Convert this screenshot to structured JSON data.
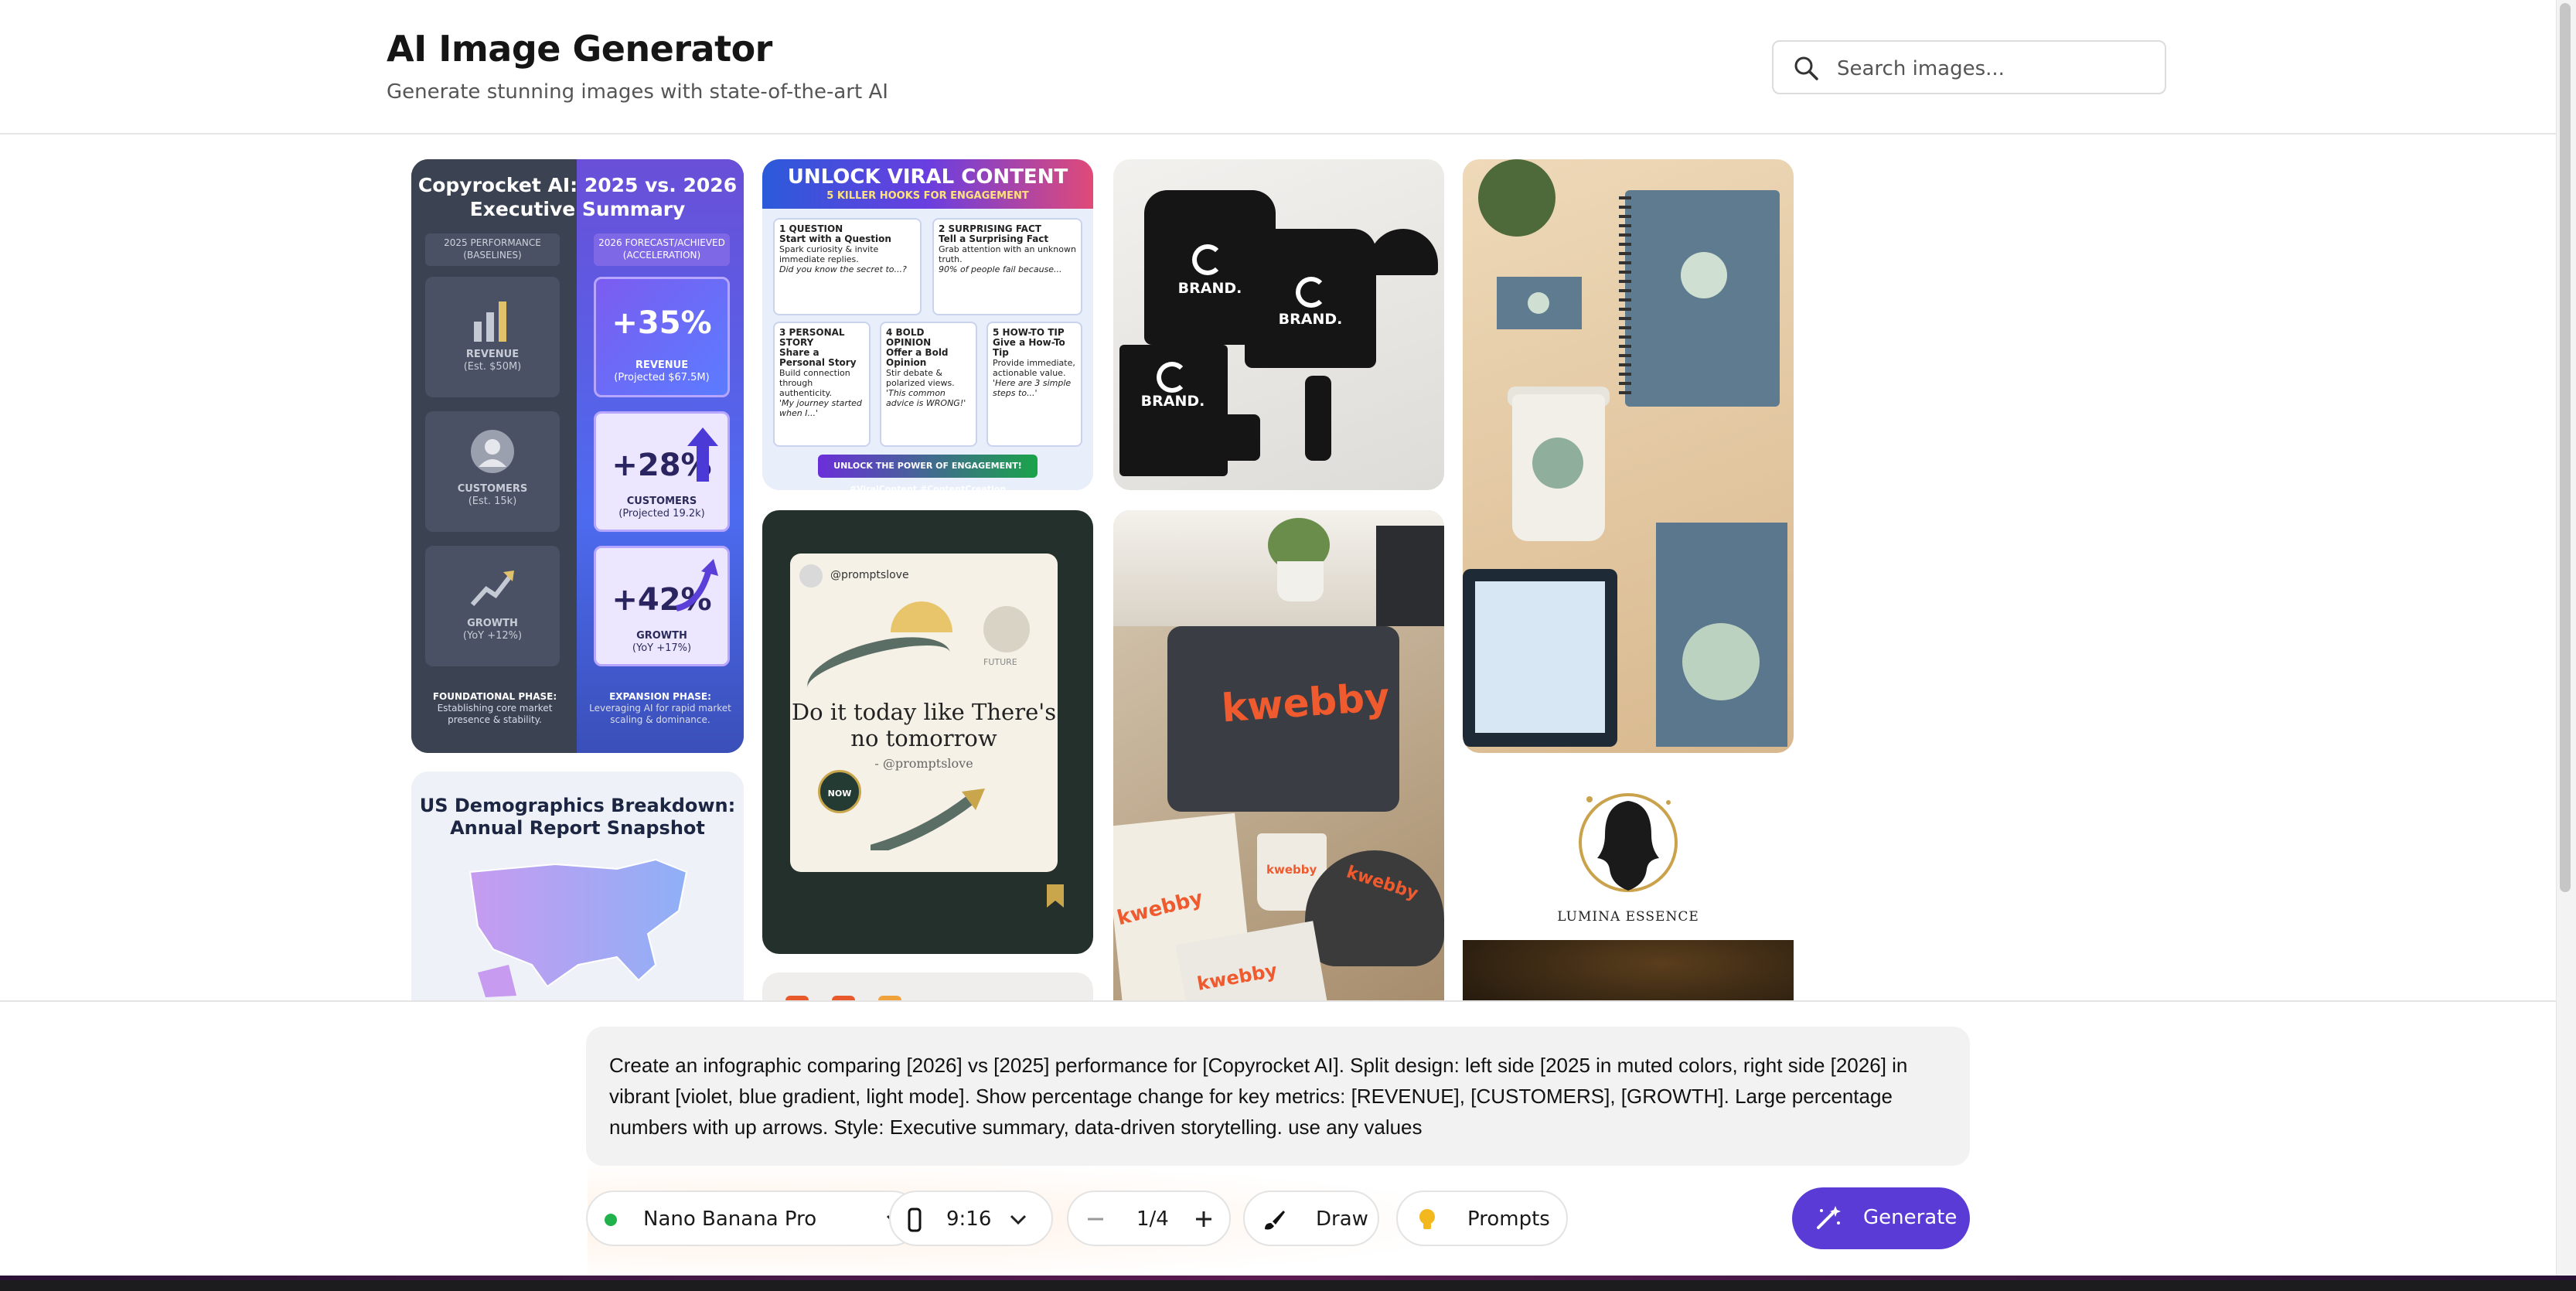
{
  "header": {
    "title": "AI Image Generator",
    "subtitle": "Generate stunning images with state-of-the-art AI",
    "search_placeholder": "Search images..."
  },
  "gallery": {
    "infographic": {
      "title": "Copyrocket AI: 2025 vs. 2026 Executive Summary",
      "left_header": "2025 PERFORMANCE (BASELINES)",
      "right_header": "2026 FORECAST/ACHIEVED (ACCELERATION)",
      "left_tiles": [
        {
          "label": "REVENUE",
          "sub": "(Est. $50M)"
        },
        {
          "label": "CUSTOMERS",
          "sub": "(Est. 15k)"
        },
        {
          "label": "GROWTH",
          "sub": "(YoY +12%)"
        }
      ],
      "right_tiles": [
        {
          "value": "+35%",
          "label": "REVENUE",
          "sub": "(Projected $67.5M)"
        },
        {
          "value": "+28%",
          "label": "CUSTOMERS",
          "sub": "(Projected 19.2k)"
        },
        {
          "value": "+42%",
          "label": "GROWTH",
          "sub": "(YoY +17%)"
        }
      ],
      "foot_left_title": "FOUNDATIONAL PHASE:",
      "foot_left_text": "Establishing core market presence & stability.",
      "foot_right_title": "EXPANSION PHASE:",
      "foot_right_text": "Leveraging AI for rapid market scaling & dominance."
    },
    "viral": {
      "title": "UNLOCK VIRAL CONTENT",
      "subtitle": "5 KILLER HOOKS FOR ENGAGEMENT",
      "hooks": [
        {
          "head": "1 QUESTION",
          "title": "Start with a Question",
          "text": "Spark curiosity & invite immediate replies.",
          "sample": "Did you know the secret to...?"
        },
        {
          "head": "2 SURPRISING FACT",
          "title": "Tell a Surprising Fact",
          "text": "Grab attention with an unknown truth.",
          "sample": "90% of people fail because..."
        },
        {
          "head": "3 PERSONAL STORY",
          "title": "Share a Personal Story",
          "text": "Build connection through authenticity.",
          "sample": "'My journey started when I...'"
        },
        {
          "head": "4 BOLD OPINION",
          "title": "Offer a Bold Opinion",
          "text": "Stir debate & polarized views.",
          "sample": "'This common advice is WRONG!'"
        },
        {
          "head": "5 HOW-TO TIP",
          "title": "Give a How-To Tip",
          "text": "Provide immediate, actionable value.",
          "sample": "'Here are 3 simple steps to...'"
        }
      ],
      "banner": "UNLOCK THE POWER OF ENGAGEMENT!",
      "hashtags": "#ViralContent #ContentCreation"
    },
    "merch": {
      "brand_text": "BRAND."
    },
    "demographics": {
      "title": "US Demographics Breakdown: Annual Report Snapshot"
    },
    "quote": {
      "handle": "@promptslove",
      "text": "Do it today like There's no tomorrow",
      "signature": "- @promptslove",
      "badge": "NOW",
      "future_label": "FUTURE"
    },
    "workspace": {
      "brand_text": "kwebby"
    },
    "logo": {
      "brand_name": "LUMINA ESSENCE"
    }
  },
  "prompt": {
    "text": "Create an infographic comparing [2026] vs [2025] performance for [Copyrocket AI]. Split design: left side [2025 in muted colors, right side [2026] in vibrant [violet, blue gradient, light mode]. Show percentage change for key metrics: [REVENUE], [CUSTOMERS], [GROWTH]. Large percentage numbers with up arrows. Style: Executive summary, data-driven storytelling. use any values"
  },
  "toolbar": {
    "model": "Nano Banana Pro",
    "model_status_color": "#22b24c",
    "aspect_ratio": "9:16",
    "count": "1/4",
    "draw_label": "Draw",
    "prompts_label": "Prompts",
    "generate_label": "Generate",
    "accent_color": "#5b3bd6"
  }
}
